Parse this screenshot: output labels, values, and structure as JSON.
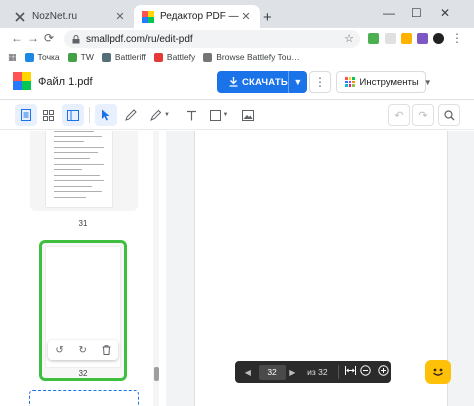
{
  "browser": {
    "tabs": [
      {
        "title": "NozNet.ru",
        "active": false
      },
      {
        "title": "Редактор PDF — бесплатный PDF",
        "active": true
      }
    ],
    "new_tab": "+",
    "window_controls": {
      "minimize": "—",
      "maximize": "☐",
      "close": "✕"
    },
    "url": "smallpdf.com/ru/edit-pdf",
    "bookmarks": [
      {
        "label": "Точка",
        "color": "#1e88e5"
      },
      {
        "label": "TW",
        "color": "#43a047"
      },
      {
        "label": "Battleriff",
        "color": "#546e7a"
      },
      {
        "label": "Battlefy",
        "color": "#e53935"
      },
      {
        "label": "Browse Battlefy Tou…",
        "color": "#757575"
      }
    ]
  },
  "app": {
    "file_name": "Файл 1.pdf",
    "download_label": "СКАЧАТЬ",
    "tools_label": "Инструменты",
    "more_label": "⋮",
    "brand_blue": "#1a73e8"
  },
  "toolbar": {
    "tools": [
      "single-page-view",
      "grid-view",
      "select",
      "pen",
      "highlighter",
      "text",
      "shape",
      "image"
    ],
    "active_view": "single-page-view",
    "active_tool": "select"
  },
  "sidebar": {
    "pages": [
      {
        "number": "31",
        "selected": false
      },
      {
        "number": "32",
        "selected": true
      }
    ],
    "selection_color": "#3fbf3f"
  },
  "pager": {
    "current_page": "32",
    "total_label": "из 32"
  }
}
